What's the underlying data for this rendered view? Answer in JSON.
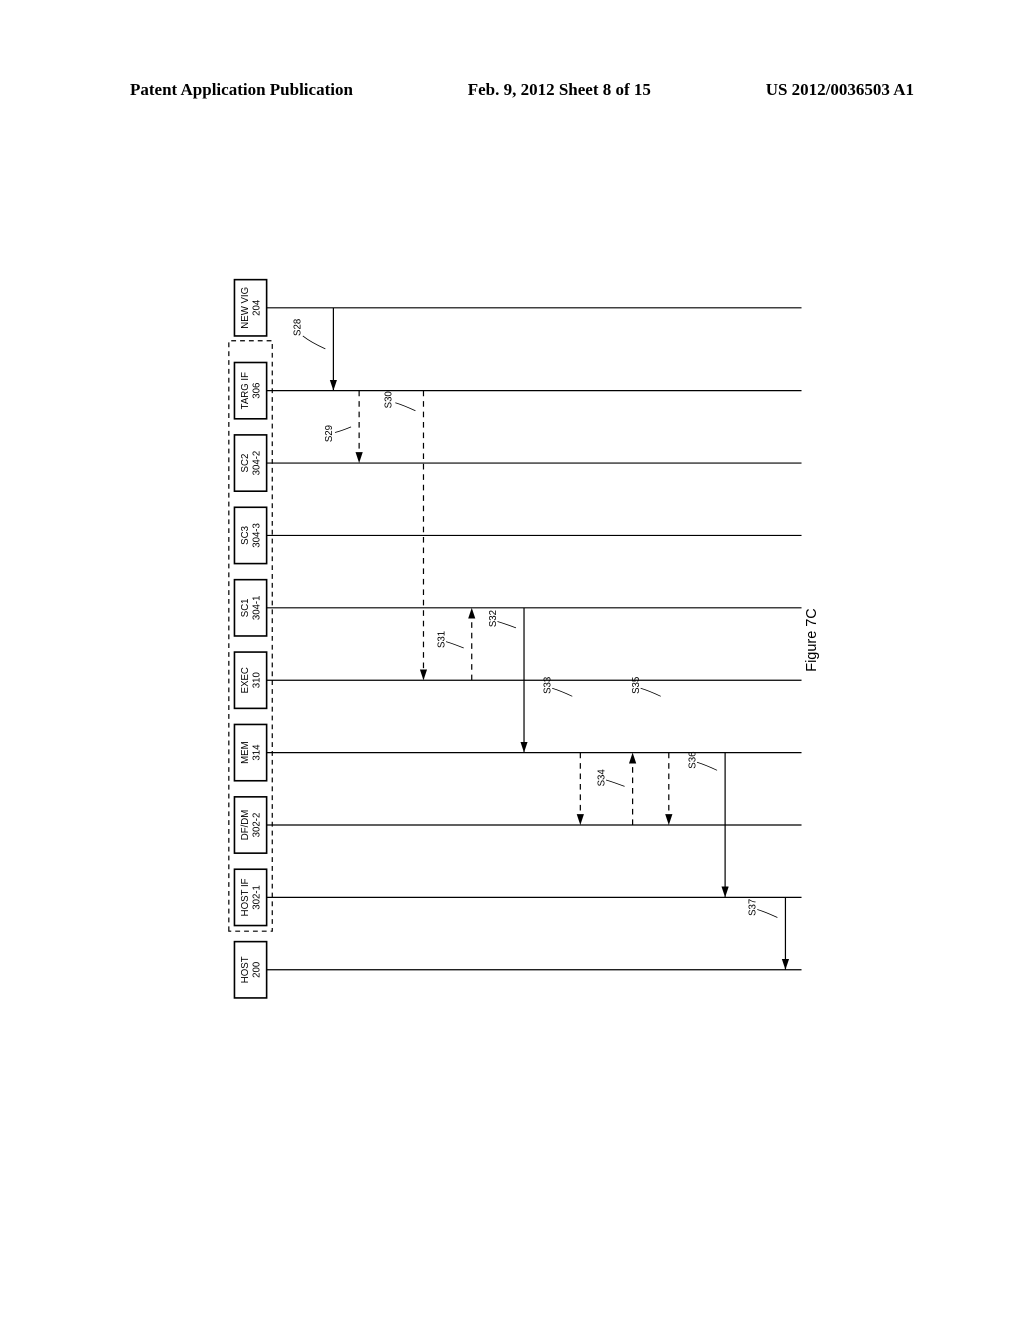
{
  "header": {
    "left": "Patent Application Publication",
    "center": "Feb. 9, 2012  Sheet 8 of 15",
    "right": "US 2012/0036503 A1"
  },
  "figure_label": "Figure 7C",
  "lifelines": [
    {
      "label1": "HOST",
      "label2": "200",
      "dashed_box": false
    },
    {
      "label1": "HOST IF",
      "label2": "302-1",
      "dashed_box": true
    },
    {
      "label1": "DF/DM",
      "label2": "302-2",
      "dashed_box": true
    },
    {
      "label1": "MEM",
      "label2": "314",
      "dashed_box": true
    },
    {
      "label1": "EXEC",
      "label2": "310",
      "dashed_box": true
    },
    {
      "label1": "SC1",
      "label2": "304-1",
      "dashed_box": true
    },
    {
      "label1": "SC3",
      "label2": "304-3",
      "dashed_box": true
    },
    {
      "label1": "SC2",
      "label2": "304-2",
      "dashed_box": true
    },
    {
      "label1": "TARG IF",
      "label2": "306",
      "dashed_box": true
    },
    {
      "label1": "NEW VIG",
      "label2": "204",
      "dashed_box": false
    }
  ],
  "steps": {
    "s28": "S28",
    "s29": "S29",
    "s30": "S30",
    "s31": "S31",
    "s32": "S32",
    "s33": "S33",
    "s34": "S34",
    "s35": "S35",
    "s36": "S36",
    "s37": "S37"
  }
}
